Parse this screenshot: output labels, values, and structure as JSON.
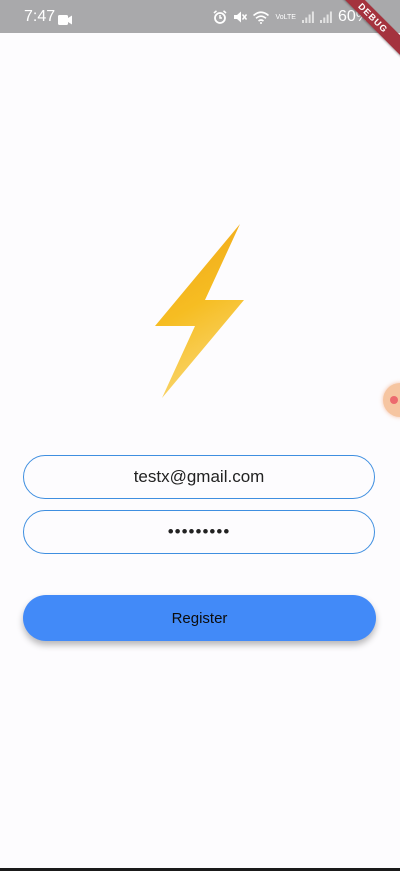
{
  "status_bar": {
    "time": "7:47",
    "battery": "60%",
    "network": "VoLTE",
    "icons": [
      "video-camera-icon",
      "alarm-icon",
      "mute-icon",
      "wifi-icon",
      "signal-icon",
      "signal-icon"
    ]
  },
  "debug_banner": "DEBUG",
  "logo": {
    "icon": "lightning-bolt-icon"
  },
  "form": {
    "email_value": "testx@gmail.com",
    "password_value": "•••••••••",
    "register_label": "Register"
  },
  "colors": {
    "accent": "#428af8",
    "field_border": "#3f8fe0",
    "bolt_top": "#f0a419",
    "bolt_bottom": "#f9d15a"
  }
}
